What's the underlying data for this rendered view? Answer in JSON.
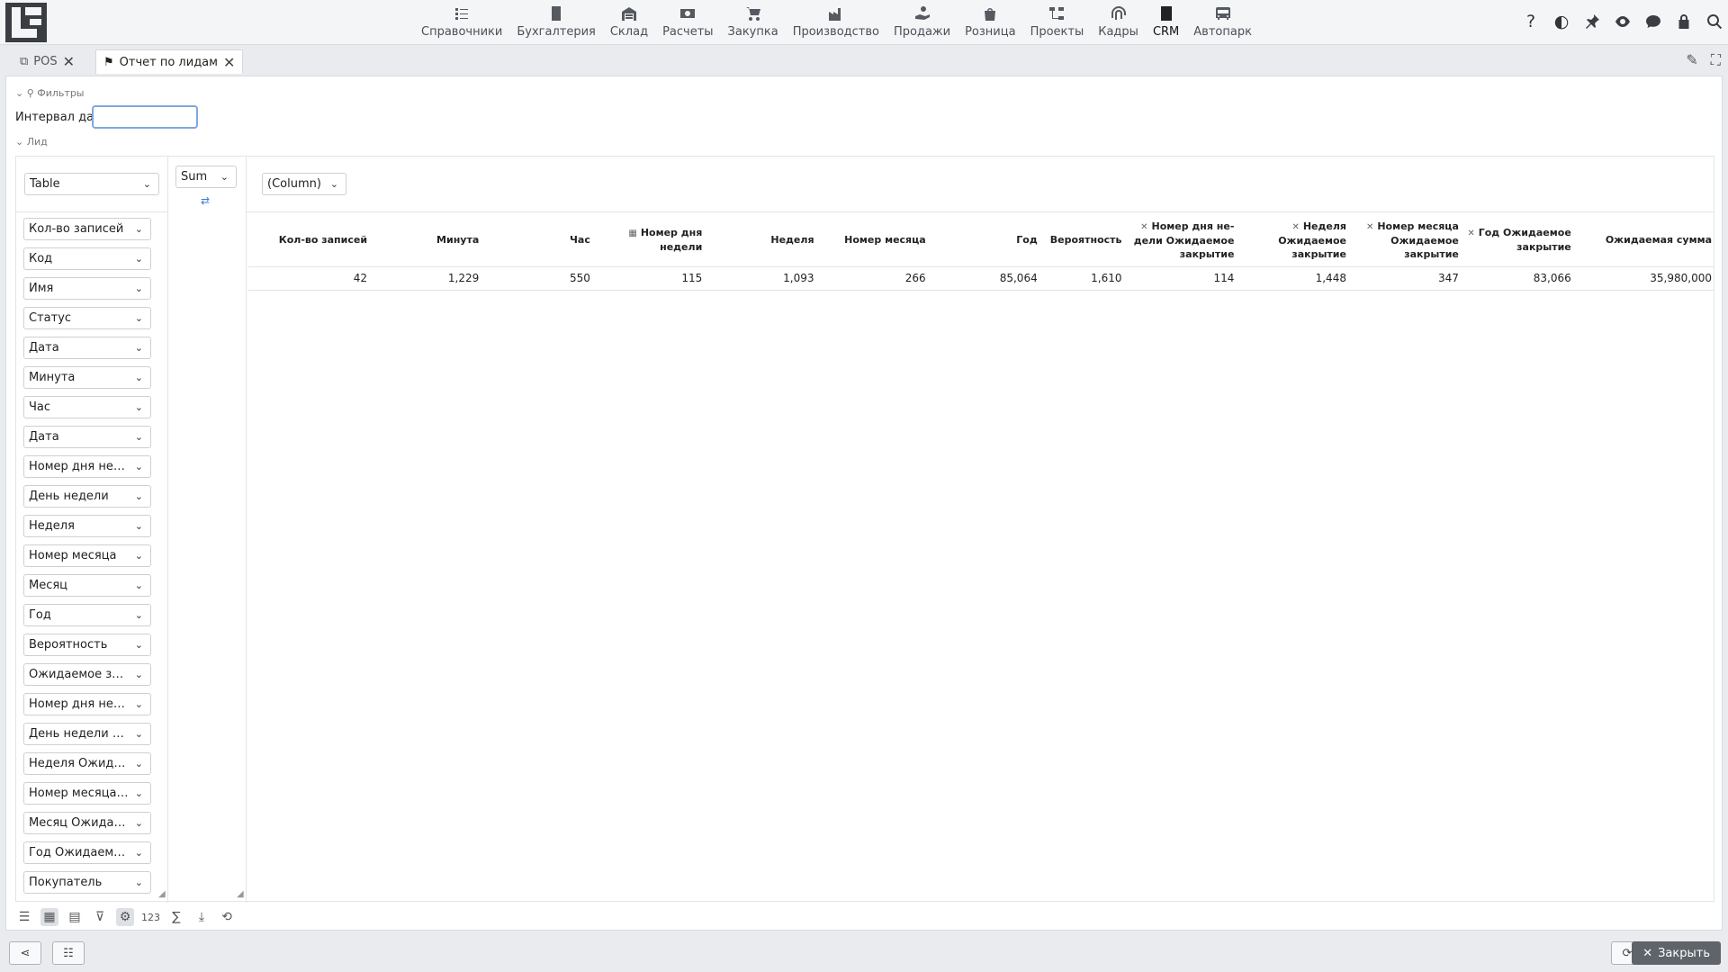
{
  "modules": [
    {
      "label": "Справочники",
      "icon": "list-check-icon"
    },
    {
      "label": "Бухгалтерия",
      "icon": "ledger-icon"
    },
    {
      "label": "Склад",
      "icon": "warehouse-icon"
    },
    {
      "label": "Расчеты",
      "icon": "money-icon"
    },
    {
      "label": "Закупка",
      "icon": "cart-icon"
    },
    {
      "label": "Производство",
      "icon": "factory-icon"
    },
    {
      "label": "Продажи",
      "icon": "hand-coin-icon"
    },
    {
      "label": "Розница",
      "icon": "shopping-bag-icon"
    },
    {
      "label": "Проекты",
      "icon": "project-tree-icon"
    },
    {
      "label": "Кадры",
      "icon": "fingerprint-icon"
    },
    {
      "label": "CRM",
      "icon": "contact-card-icon"
    },
    {
      "label": "Автопарк",
      "icon": "bus-icon"
    }
  ],
  "tabs": [
    {
      "label": "POS"
    },
    {
      "label": "Отчет по лидам"
    }
  ],
  "filters": {
    "header": "Фильтры",
    "date_label": "Интервал дат",
    "date_value": "",
    "lead_header": "Лид"
  },
  "pivot": {
    "renderer": "Table",
    "aggregator": "Sum",
    "column_field": "(Column)",
    "fields": [
      "Кол-во записей",
      "Код",
      "Имя",
      "Статус",
      "Дата",
      "Минута",
      "Час",
      "Дата",
      "Номер дня недели",
      "День недели",
      "Неделя",
      "Номер месяца",
      "Месяц",
      "Год",
      "Вероятность",
      "Ожидаемое закрытие",
      "Номер дня недели Ожидаемое закрытие",
      "День недели Ожидаемое закрытие",
      "Неделя Ожидаемое закрытие",
      "Номер месяца Ожидаемое закрытие",
      "Месяц Ожидаемое закрытие",
      "Год Ожидаемое закрытие",
      "Покупатель"
    ],
    "columns": [
      {
        "label": "Кол-во записей",
        "value": "42",
        "marker": ""
      },
      {
        "label": "Минута",
        "value": "1,229",
        "marker": ""
      },
      {
        "label": "Час",
        "value": "550",
        "marker": ""
      },
      {
        "label": "Номер дня недели",
        "value": "115",
        "marker": "calendar"
      },
      {
        "label": "Неделя",
        "value": "1,093",
        "marker": ""
      },
      {
        "label": "Номер месяца",
        "value": "266",
        "marker": ""
      },
      {
        "label": "Год",
        "value": "85,064",
        "marker": ""
      },
      {
        "label": "Вероятность",
        "value": "1,610",
        "marker": ""
      },
      {
        "label": "Номер дня не­дели Ожидаемое закрытие",
        "value": "114",
        "marker": "x"
      },
      {
        "label": "Неделя Ожидае­мое закрытие",
        "value": "1,448",
        "marker": "x"
      },
      {
        "label": "Номер месяца Ожидаемое закрытие",
        "value": "347",
        "marker": "x"
      },
      {
        "label": "Год Ожидаемое закрытие",
        "value": "83,066",
        "marker": "x"
      },
      {
        "label": "Ожидаемая сумма",
        "value": "35,980,000",
        "marker": ""
      }
    ]
  },
  "toolbar": {
    "count_label": "123"
  },
  "footer": {
    "close_label": "Закрыть"
  }
}
